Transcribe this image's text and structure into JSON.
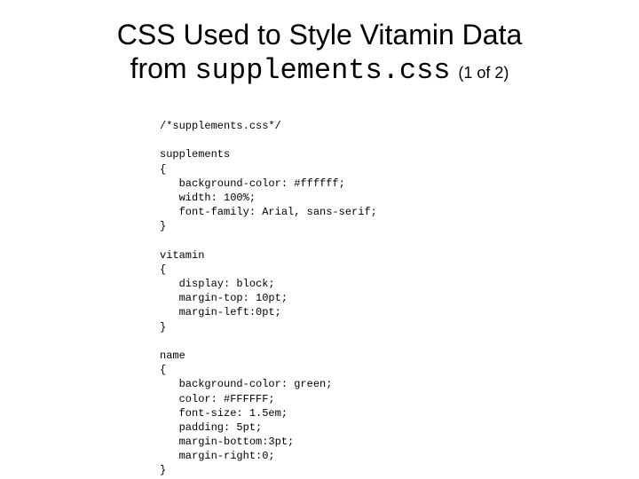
{
  "heading": {
    "line1": "CSS Used to Style Vitamin Data",
    "line2_prefix": "from ",
    "line2_mono": "supplements.css",
    "page_indicator": "(1 of 2)"
  },
  "code": {
    "comment": "/*supplements.css*/",
    "block1_selector": "supplements",
    "block1_open": "{",
    "block1_l1": "   background-color: #ffffff;",
    "block1_l2": "   width: 100%;",
    "block1_l3": "   font-family: Arial, sans-serif;",
    "block1_close": "}",
    "block2_selector": "vitamin",
    "block2_open": "{",
    "block2_l1": "   display: block;",
    "block2_l2": "   margin-top: 10pt;",
    "block2_l3": "   margin-left:0pt;",
    "block2_close": "}",
    "block3_selector": "name",
    "block3_open": "{",
    "block3_l1": "   background-color: green;",
    "block3_l2": "   color: #FFFFFF;",
    "block3_l3": "   font-size: 1.5em;",
    "block3_l4": "   padding: 5pt;",
    "block3_l5": "   margin-bottom:3pt;",
    "block3_l6": "   margin-right:0;",
    "block3_close": "}"
  }
}
